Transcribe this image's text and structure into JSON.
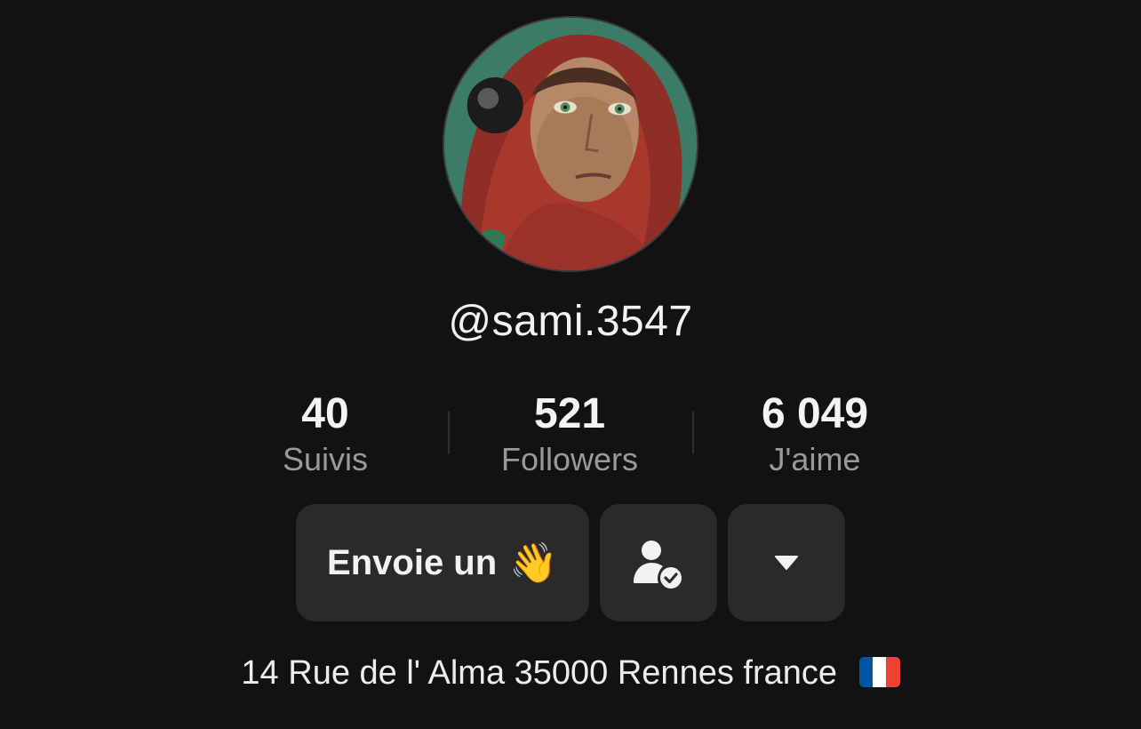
{
  "profile": {
    "avatar_alt": "profile-photo",
    "username": "@sami.3547",
    "address": "14 Rue de l' Alma 35000 Rennes france"
  },
  "stats": [
    {
      "value": "40",
      "label": "Suivis"
    },
    {
      "value": "521",
      "label": "Followers"
    },
    {
      "value": "6 049",
      "label": "J'aime"
    }
  ],
  "buttons": {
    "wave_label": "Envoie un",
    "wave_emoji": "👋",
    "friend_icon": "person-check-icon",
    "more_icon": "caret-down-icon"
  },
  "colors": {
    "background": "#121212",
    "button_bg": "#2a2a2a",
    "muted_text": "#9a9a9a",
    "flag": [
      "#0055A4",
      "#FFFFFF",
      "#EF4135"
    ]
  }
}
